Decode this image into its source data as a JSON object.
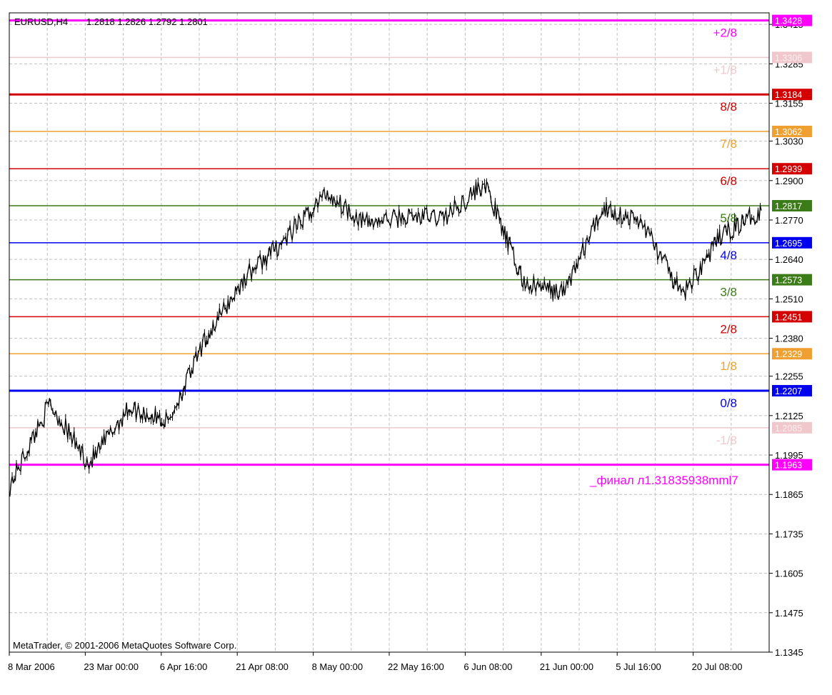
{
  "header": {
    "symbol": "EURUSD,H4",
    "ohlc": "1.2818 1.2826 1.2792 1.2801"
  },
  "copyright": "MetaTrader, © 2001-2006 MetaQuotes Software Corp.",
  "final_label": "_финал л1.31835938mml7",
  "colors": {
    "background": "#ffffff",
    "grid": "#c0c0c0",
    "price": "#000000",
    "magenta": "#ff00ff",
    "pink": "#f0c8cc",
    "red": "#d40000",
    "orange": "#f0a030",
    "green": "#3c7c18",
    "blue": "#0000f0"
  },
  "chart_data": {
    "type": "line",
    "title": "EURUSD,H4",
    "y_axis_ticks": [
      "1.3415",
      "1.3285",
      "1.3155",
      "1.3030",
      "1.2900",
      "1.2770",
      "1.2640",
      "1.2510",
      "1.2380",
      "1.2255",
      "1.2125",
      "1.1995",
      "1.1865",
      "1.1735",
      "1.1605",
      "1.1475",
      "1.1345"
    ],
    "x_axis_ticks": [
      "8 Mar 2006",
      "23 Mar 00:00",
      "6 Apr 16:00",
      "21 Apr 08:00",
      "8 May 00:00",
      "22 May 16:00",
      "6 Jun 08:00",
      "21 Jun 00:00",
      "5 Jul 16:00",
      "20 Jul 08:00"
    ],
    "ylim": [
      1.1345,
      1.3453
    ],
    "grid": true,
    "levels": [
      {
        "label": "+2/8",
        "price": 1.3428,
        "price_text": "1.3428",
        "color": "#ff00ff",
        "thick": true
      },
      {
        "label": "+1/8",
        "price": 1.3306,
        "price_text": "1.3306",
        "color": "#f0c8cc",
        "thick": false
      },
      {
        "label": "8/8",
        "price": 1.3184,
        "price_text": "1.3184",
        "color": "#d40000",
        "thick": true
      },
      {
        "label": "7/8",
        "price": 1.3062,
        "price_text": "1.3062",
        "color": "#f0a030",
        "thick": false
      },
      {
        "label": "6/8",
        "price": 1.2939,
        "price_text": "1.2939",
        "color": "#d40000",
        "thick": false
      },
      {
        "label": "5/8",
        "price": 1.2817,
        "price_text": "1.2817",
        "color": "#3c7c18",
        "thick": false
      },
      {
        "label": "4/8",
        "price": 1.2695,
        "price_text": "1.2695",
        "color": "#0000f0",
        "thick": false
      },
      {
        "label": "3/8",
        "price": 1.2573,
        "price_text": "1.2573",
        "color": "#3c7c18",
        "thick": false
      },
      {
        "label": "2/8",
        "price": 1.2451,
        "price_text": "1.2451",
        "color": "#d40000",
        "thick": false
      },
      {
        "label": "1/8",
        "price": 1.2329,
        "price_text": "1.2329",
        "color": "#f0a030",
        "thick": false
      },
      {
        "label": "0/8",
        "price": 1.2207,
        "price_text": "1.2207",
        "color": "#0000f0",
        "thick": true
      },
      {
        "label": "-1/8",
        "price": 1.2085,
        "price_text": "1.2085",
        "color": "#f0c8cc",
        "thick": false
      },
      {
        "label": "",
        "price": 1.1963,
        "price_text": "1.1963",
        "color": "#ff00ff",
        "thick": true
      }
    ],
    "series": [
      {
        "x": [
          "8 Mar 2006",
          "15 Mar",
          "23 Mar 00:00",
          "30 Mar",
          "6 Apr 16:00",
          "14 Apr",
          "21 Apr 08:00",
          "28 Apr",
          "8 May 00:00",
          "15 May",
          "22 May 16:00",
          "30 May",
          "6 Jun 08:00",
          "14 Jun",
          "21 Jun 00:00",
          "28 Jun",
          "5 Jul 16:00",
          "12 Jul",
          "20 Jul 08:00",
          "24 Jul"
        ],
        "values": [
          1.1895,
          1.2165,
          1.1965,
          1.215,
          1.2105,
          1.239,
          1.259,
          1.271,
          1.286,
          1.276,
          1.278,
          1.278,
          1.289,
          1.256,
          1.253,
          1.281,
          1.276,
          1.252,
          1.272,
          1.2801
        ]
      }
    ]
  }
}
